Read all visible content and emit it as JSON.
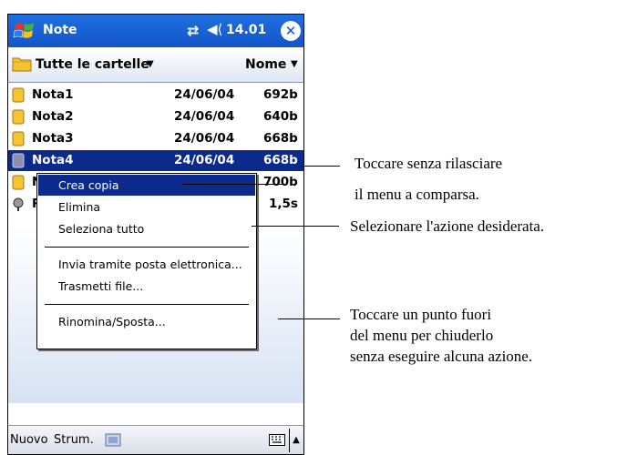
{
  "titlebar": {
    "app_title": "Note",
    "clock": "14.01",
    "start_icon": "windows-flag-icon",
    "sync_icon": "sync-arrows-icon",
    "volume_icon": "speaker-icon",
    "close_glyph": "✕"
  },
  "folderbar": {
    "folder_label": "Tutte le cartelle",
    "sort_label": "Nome"
  },
  "files": [
    {
      "name": "Nota1",
      "date": "24/06/04",
      "size": "692b"
    },
    {
      "name": "Nota2",
      "date": "24/06/04",
      "size": "640b"
    },
    {
      "name": "Nota3",
      "date": "24/06/04",
      "size": "668b"
    },
    {
      "name": "Nota4",
      "date": "24/06/04",
      "size": "668b"
    },
    {
      "name": "N",
      "date": "",
      "size": "700b"
    },
    {
      "name": "R",
      "date": "",
      "size": "1,5s"
    }
  ],
  "popup_menu": {
    "items": [
      "Crea copia",
      "Elimina",
      "Seleziona tutto",
      "Invia tramite posta elettronica...",
      "Trasmetti file...",
      "Rinomina/Sposta..."
    ],
    "highlighted_index": 0
  },
  "bottombar": {
    "new_label": "Nuovo",
    "tools_label": "Strum."
  },
  "annotations": {
    "tap_hold_line1": "Toccare senza rilasciare",
    "tap_hold_line2": "il menu a comparsa.",
    "select_action": "Selezionare l'azione desiderata.",
    "close_line1": "Toccare un punto fuori",
    "close_line2": "del menu per chiuderlo",
    "close_line3": "senza eseguire alcuna azione."
  },
  "colors": {
    "titlebar": "#1356c8",
    "selection": "#0b2a8c"
  }
}
